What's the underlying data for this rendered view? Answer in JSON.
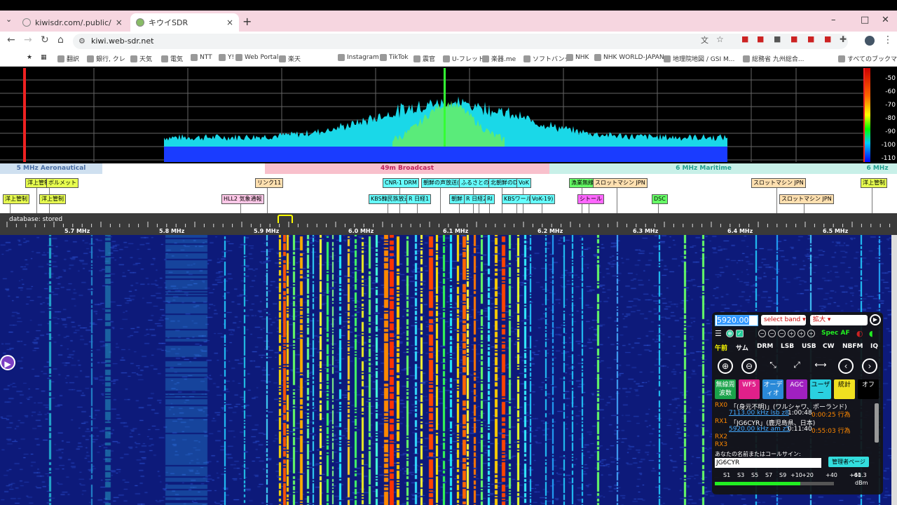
{
  "browser": {
    "tabs": [
      {
        "title": "kiwisdr.com/.public/",
        "close": "×"
      },
      {
        "title": "キウイSDR",
        "close": "×"
      }
    ],
    "new_tab": "+",
    "url": "kiwi.web-sdr.net",
    "bookmarks": [
      "翻訳",
      "銀行, クレ",
      "天気",
      "電気",
      "NTT",
      "Y!",
      "Web Portal",
      "楽天",
      "Instagram",
      "TikTok",
      "震官",
      "U-フレット",
      "楽器.me",
      "ソフトバンク",
      "NHK",
      "NHK WORLD-JAPAN",
      "地理院地図 / GSI M...",
      "総務省 九州総合...",
      "すべてのブックマーク"
    ],
    "window_controls": [
      "–",
      "□",
      "✕"
    ]
  },
  "spectrum": {
    "db_labels": [
      "-50",
      "-60",
      "-70",
      "-80",
      "-90",
      "-100",
      "-110"
    ]
  },
  "bands": [
    {
      "label": "5 MHz Aeronautical",
      "color": "#cfe0f0",
      "text_color": "#4a6fa5"
    },
    {
      "label": "49m Broadcast",
      "color": "#f8c0cc",
      "text_color": "#c0205a"
    },
    {
      "label": "6 MHz Maritime",
      "color": "#c8f0e8",
      "text_color": "#20a090"
    },
    {
      "label": "6 MHz",
      "color": "#c8f0e8",
      "text_color": "#20a090"
    }
  ],
  "stations": [
    {
      "label": "洋上管制",
      "style": "y"
    },
    {
      "label": "洋上管制",
      "style": "y"
    },
    {
      "label": "ボルメット",
      "style": "y"
    },
    {
      "label": "洋上管制",
      "style": "y"
    },
    {
      "label": "リンク11",
      "style": "o"
    },
    {
      "label": "HLL2 気象通報",
      "style": "p"
    },
    {
      "label": "CNR-1 DRM",
      "style": "c"
    },
    {
      "label": "KBS韓民族放送",
      "style": "c"
    },
    {
      "label": "R 日経1",
      "style": "c"
    },
    {
      "label": "朝鮮の声放送(1",
      "style": "c"
    },
    {
      "label": "ふるさとの",
      "style": "c"
    },
    {
      "label": "北朝鮮のDR",
      "style": "c"
    },
    {
      "label": "VoK",
      "style": "c"
    },
    {
      "label": "朝鮮",
      "style": "c"
    },
    {
      "label": "R 日経2",
      "style": "c"
    },
    {
      "label": "RI",
      "style": "c"
    },
    {
      "label": "KBSワール",
      "style": "c"
    },
    {
      "label": "VoK-19)",
      "style": "c"
    },
    {
      "label": "漁業無線",
      "style": "g"
    },
    {
      "label": "スロットマシン JPN",
      "style": "o"
    },
    {
      "label": "シトール",
      "style": "m"
    },
    {
      "label": "DSC",
      "style": "g"
    },
    {
      "label": "スロットマシン JPN",
      "style": "o"
    },
    {
      "label": "スロットマシン JPN",
      "style": "o"
    },
    {
      "label": "洋上管制",
      "style": "y"
    }
  ],
  "scale": {
    "database_status": "database: stored",
    "mhz_labels": [
      "5.7 MHz",
      "5.8 MHz",
      "5.9 MHz",
      "6.0 MHz",
      "6.1 MHz",
      "6.2 MHz",
      "6.3 MHz",
      "6.4 MHz",
      "6.5 MHz"
    ]
  },
  "panel": {
    "frequency": "5920.00",
    "band_select": "select band",
    "zoom_select": "拡大",
    "spec_af": "Spec AF",
    "modes": [
      "午前",
      "サム",
      "DRM",
      "LSB",
      "USB",
      "CW",
      "NBFM",
      "IQ"
    ],
    "zoom_controls": [
      "⊕",
      "⊖",
      "⤡",
      "⤢",
      "⟷",
      "‹",
      "›"
    ],
    "buttons": [
      {
        "label": "無線周波数",
        "bg": "#1aa34a",
        "fg": "#fff"
      },
      {
        "label": "WF5",
        "bg": "#e0208a",
        "fg": "#fff"
      },
      {
        "label": "オーディオ",
        "bg": "#2a8ad8",
        "fg": "#fff"
      },
      {
        "label": "AGC",
        "bg": "#a020c0",
        "fg": "#fff"
      },
      {
        "label": "ユーザー",
        "bg": "#2ad0e0",
        "fg": "#000"
      },
      {
        "label": "統計",
        "bg": "#f0e020",
        "fg": "#000"
      },
      {
        "label": "オフ",
        "bg": "#000",
        "fg": "#fff"
      }
    ],
    "rx": [
      {
        "id": "RX0",
        "name": "「(身元不明)」(ワルシャワ、ポーランド)",
        "detail": "7113.00 kHz lsb z8",
        "time": "1:00:48",
        "extra": "0:00:25 行為"
      },
      {
        "id": "RX1",
        "name": "「JG6CYR」(鹿児島県、日本)",
        "detail": "5920.00 kHz am z5",
        "time": "0:11:40",
        "extra": "0:55:03 行為"
      },
      {
        "id": "RX2",
        "name": "",
        "detail": "",
        "time": "",
        "extra": ""
      },
      {
        "id": "RX3",
        "name": "",
        "detail": "",
        "time": "",
        "extra": ""
      }
    ],
    "name_prompt": "あなたの名前またはコールサイン:",
    "name_value": "JG6CYR",
    "admin_button": "管理者ページ",
    "smeter_labels": [
      "S1",
      "S3",
      "S5",
      "S7",
      "S9",
      "+10",
      "+20",
      "+40",
      "+60"
    ],
    "smeter_value": "-41.3",
    "smeter_unit": "dBm",
    "smeter_level": 0.72
  },
  "colors": {
    "accent": "#ff2d2d",
    "waterfall_bg": "#0d1a7a"
  }
}
